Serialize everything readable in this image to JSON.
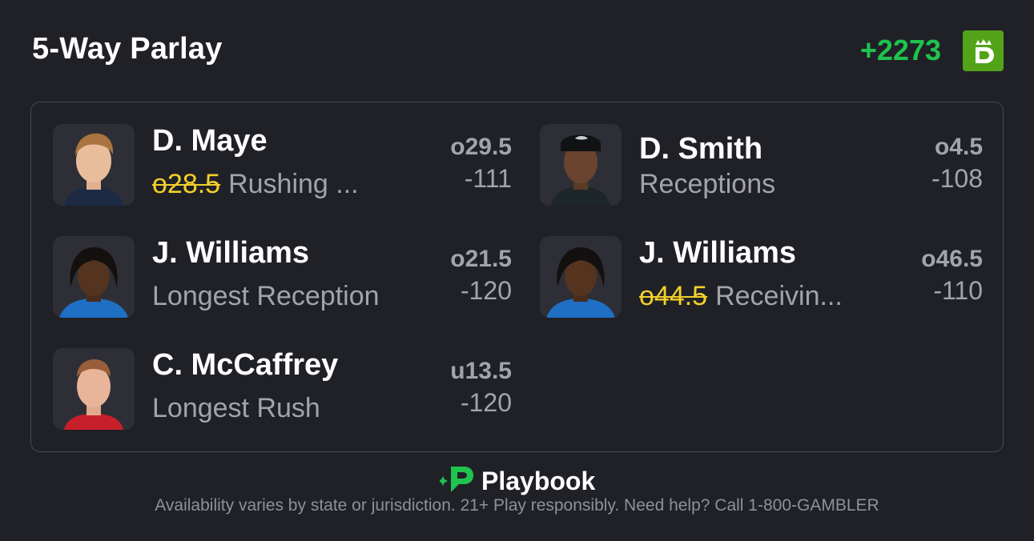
{
  "header": {
    "title": "5-Way Parlay",
    "odds": "+2273",
    "sportsbook_icon": "draftkings-logo-icon"
  },
  "legs": [
    {
      "player": "D. Maye",
      "previous_line": "o28.5",
      "market": "Rushing ...",
      "line": "o29.5",
      "price": "-111",
      "avatar_icon": "player-headshot-icon"
    },
    {
      "player": "D. Smith",
      "previous_line": "",
      "market": "Receptions",
      "line": "o4.5",
      "price": "-108",
      "avatar_icon": "player-headshot-icon"
    },
    {
      "player": "J. Williams",
      "previous_line": "",
      "market": "Longest Reception",
      "line": "o21.5",
      "price": "-120",
      "avatar_icon": "player-headshot-icon"
    },
    {
      "player": "J. Williams",
      "previous_line": "o44.5",
      "market": "Receivin...",
      "line": "o46.5",
      "price": "-110",
      "avatar_icon": "player-headshot-icon"
    },
    {
      "player": "C. McCaffrey",
      "previous_line": "",
      "market": "Longest Rush",
      "line": "u13.5",
      "price": "-120",
      "avatar_icon": "player-headshot-icon"
    }
  ],
  "footer": {
    "brand": "Playbook",
    "disclaimer": "Availability varies by state or jurisdiction. 21+ Play responsibly. Need help? Call 1-800-GAMBLER"
  },
  "colors": {
    "background": "#202127",
    "odds_green": "#1fc34d",
    "draftkings_green": "#53a318",
    "strike_yellow": "#f2d02c",
    "muted_text": "#a3a4ab"
  }
}
